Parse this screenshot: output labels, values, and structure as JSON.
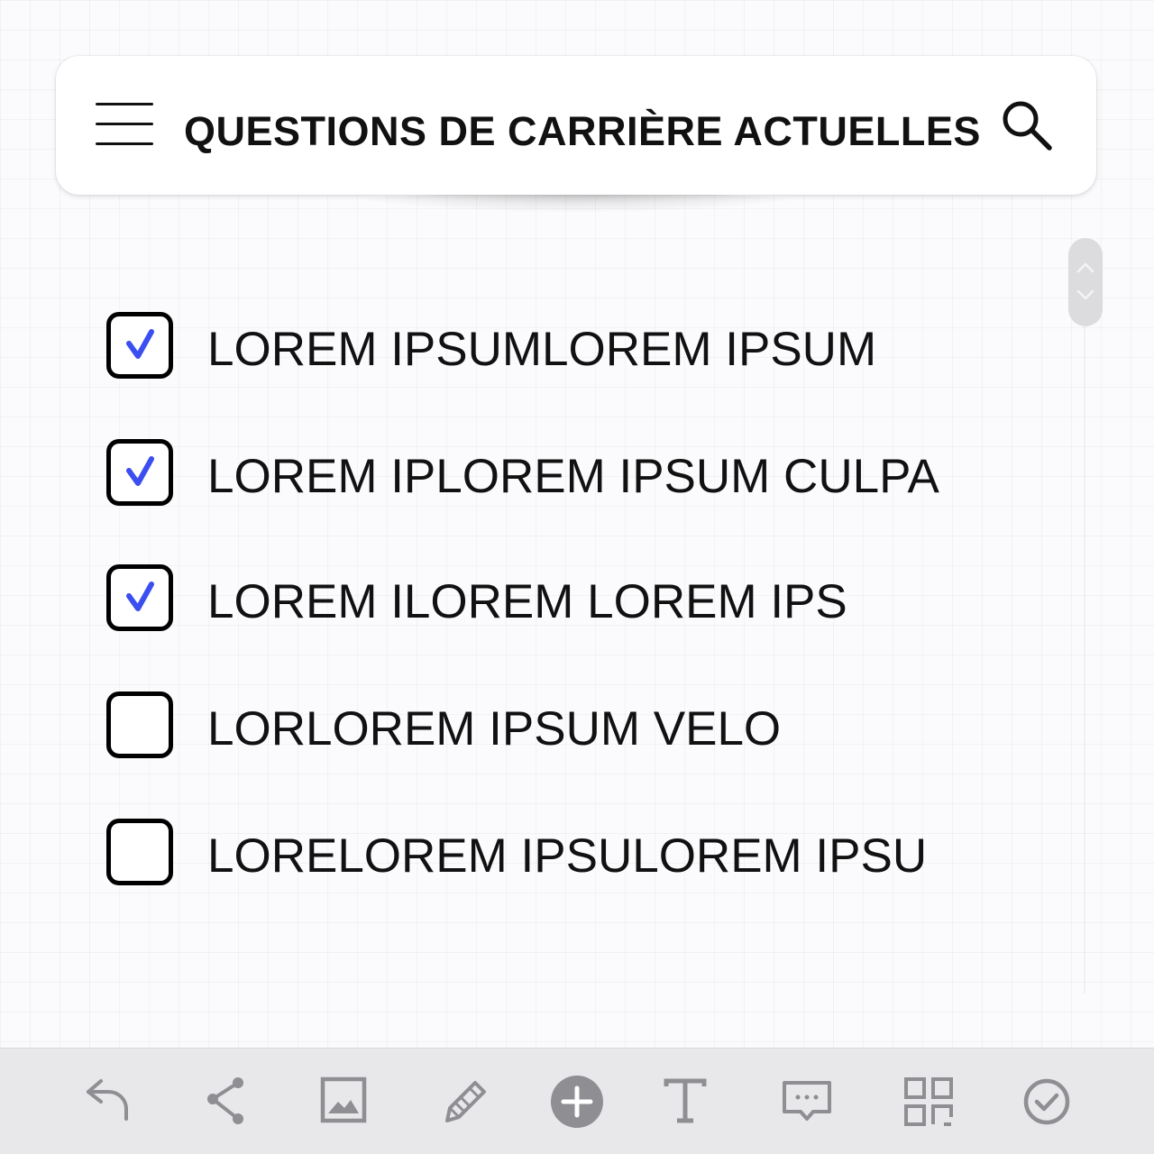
{
  "header": {
    "title": "QUESTIONS DE CARRIÈRE ACTUELLES",
    "menu_icon": "hamburger-menu-icon",
    "search_icon": "search-icon"
  },
  "checklist": {
    "items": [
      {
        "label": "LOREM IPSUMLOREM IPSUM",
        "checked": true
      },
      {
        "label": "LOREM IPLOREM IPSUM CULPA",
        "checked": true
      },
      {
        "label": "LOREM ILOREM LOREM IPS",
        "checked": true
      },
      {
        "label": "LORLOREM IPSUM VELO",
        "checked": false
      },
      {
        "label": "LORELOREM IPSULOREM IPSU",
        "checked": false
      }
    ],
    "check_color": "#3b4ef0"
  },
  "toolbar": {
    "tools": [
      "undo-icon",
      "share-icon",
      "image-icon",
      "pencil-icon",
      "add-icon",
      "text-icon",
      "comment-icon",
      "grid-icon",
      "check-circle-icon"
    ]
  },
  "colors": {
    "accent": "#3b4ef0",
    "toolbar_bg": "#e8e8ea",
    "icon_gray": "#8e8e93"
  }
}
